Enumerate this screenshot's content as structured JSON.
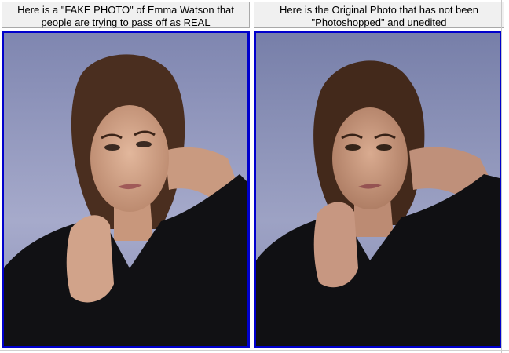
{
  "panels": [
    {
      "caption": "Here is a \"FAKE PHOTO\" of Emma Watson that\npeople are trying to pass off as REAL",
      "image": {
        "subject": "woman-portrait-edited",
        "background_color": "#9aa0c4"
      }
    },
    {
      "caption": "Here is the Original Photo that has not been\n\"Photoshopped\" and unedited",
      "image": {
        "subject": "woman-portrait-original",
        "background_color": "#8f96bd"
      }
    }
  ],
  "colors": {
    "frame_border": "#0000cc",
    "caption_bg": "#f0f0f0",
    "caption_border": "#a9a9a9"
  }
}
